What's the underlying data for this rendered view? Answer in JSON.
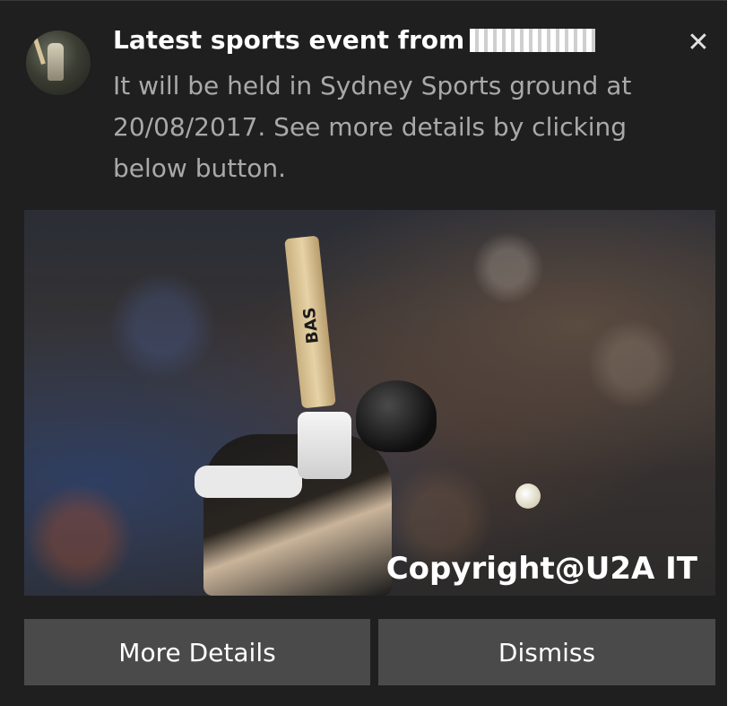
{
  "notification": {
    "title": "Latest sports event from",
    "body": "It will be held in Sydney Sports ground at 20/08/2017. See more details by clicking below button.",
    "close_glyph": "✕"
  },
  "hero": {
    "bat_text": "BAS",
    "watermark": "Copyright@U2A IT"
  },
  "actions": {
    "more_details": "More Details",
    "dismiss": "Dismiss"
  },
  "icons": {
    "close": "close-icon",
    "avatar": "app-avatar"
  },
  "colors": {
    "background": "#1f1f1f",
    "button": "#4a4a4a",
    "title": "#ffffff",
    "body": "#a9a9a9"
  }
}
